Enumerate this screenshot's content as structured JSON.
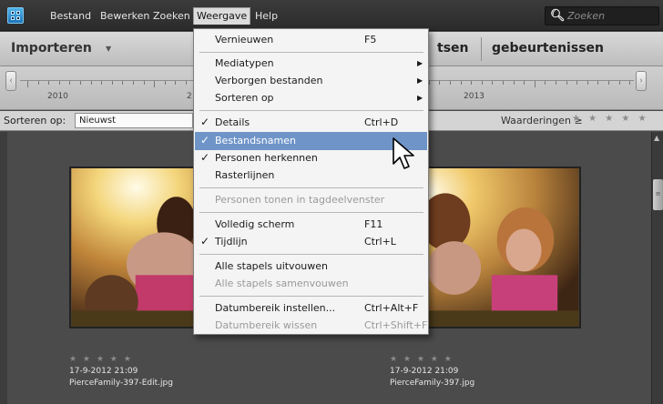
{
  "menubar": {
    "items": [
      "Bestand",
      "Bewerken",
      "Zoeken",
      "Weergave",
      "Help"
    ],
    "search_placeholder": "Zoeken",
    "search_icon": "magnifier-dropdown-icon"
  },
  "toolbar": {
    "import_label": "Importeren",
    "tab_1": "tsen",
    "tab_2": "gebeurtenissen"
  },
  "timeline": {
    "years": [
      "2010",
      "2",
      "2013"
    ]
  },
  "sortbar": {
    "sort_label": "Sorteren op:",
    "sort_value": "Nieuwst",
    "ratings_label": "Waarderingen  ≥",
    "ratings_stars": "★ ★ ★ ★ ★"
  },
  "photos": [
    {
      "stars": "★ ★ ★ ★ ★",
      "date": "17-9-2012 21:09",
      "filename": "PierceFamily-397-Edit.jpg"
    },
    {
      "stars": "★ ★ ★ ★ ★",
      "date": "17-9-2012 21:09",
      "filename": "PierceFamily-397.jpg"
    }
  ],
  "weergave_menu": {
    "items": [
      {
        "label": "Vernieuwen",
        "shortcut": "F5",
        "checked": false,
        "submenu": false,
        "disabled": false,
        "highlight": false
      },
      {
        "label": "Mediatypen",
        "shortcut": "",
        "checked": false,
        "submenu": true,
        "disabled": false,
        "highlight": false
      },
      {
        "label": "Verborgen bestanden",
        "shortcut": "",
        "checked": false,
        "submenu": true,
        "disabled": false,
        "highlight": false
      },
      {
        "label": "Sorteren op",
        "shortcut": "",
        "checked": false,
        "submenu": true,
        "disabled": false,
        "highlight": false
      },
      {
        "label": "Details",
        "shortcut": "Ctrl+D",
        "checked": true,
        "submenu": false,
        "disabled": false,
        "highlight": false
      },
      {
        "label": "Bestandsnamen",
        "shortcut": "",
        "checked": true,
        "submenu": false,
        "disabled": false,
        "highlight": true
      },
      {
        "label": "Personen herkennen",
        "shortcut": "",
        "checked": true,
        "submenu": false,
        "disabled": false,
        "highlight": false
      },
      {
        "label": "Rasterlijnen",
        "shortcut": "",
        "checked": false,
        "submenu": false,
        "disabled": false,
        "highlight": false
      },
      {
        "label": "Personen tonen in tagdeelvenster",
        "shortcut": "",
        "checked": false,
        "submenu": false,
        "disabled": true,
        "highlight": false
      },
      {
        "label": "Volledig scherm",
        "shortcut": "F11",
        "checked": false,
        "submenu": false,
        "disabled": false,
        "highlight": false
      },
      {
        "label": "Tijdlijn",
        "shortcut": "Ctrl+L",
        "checked": true,
        "submenu": false,
        "disabled": false,
        "highlight": false
      },
      {
        "label": "Alle stapels uitvouwen",
        "shortcut": "",
        "checked": false,
        "submenu": false,
        "disabled": false,
        "highlight": false
      },
      {
        "label": "Alle stapels samenvouwen",
        "shortcut": "",
        "checked": false,
        "submenu": false,
        "disabled": true,
        "highlight": false
      },
      {
        "label": "Datumbereik instellen...",
        "shortcut": "Ctrl+Alt+F",
        "checked": false,
        "submenu": false,
        "disabled": false,
        "highlight": false
      },
      {
        "label": "Datumbereik wissen",
        "shortcut": "Ctrl+Shift+F",
        "checked": false,
        "submenu": false,
        "disabled": true,
        "highlight": false
      }
    ]
  },
  "colors": {
    "menubar_bg": "#2f2f2f",
    "highlight": "#6f95c8",
    "panel_bg": "#4b4b4b"
  }
}
